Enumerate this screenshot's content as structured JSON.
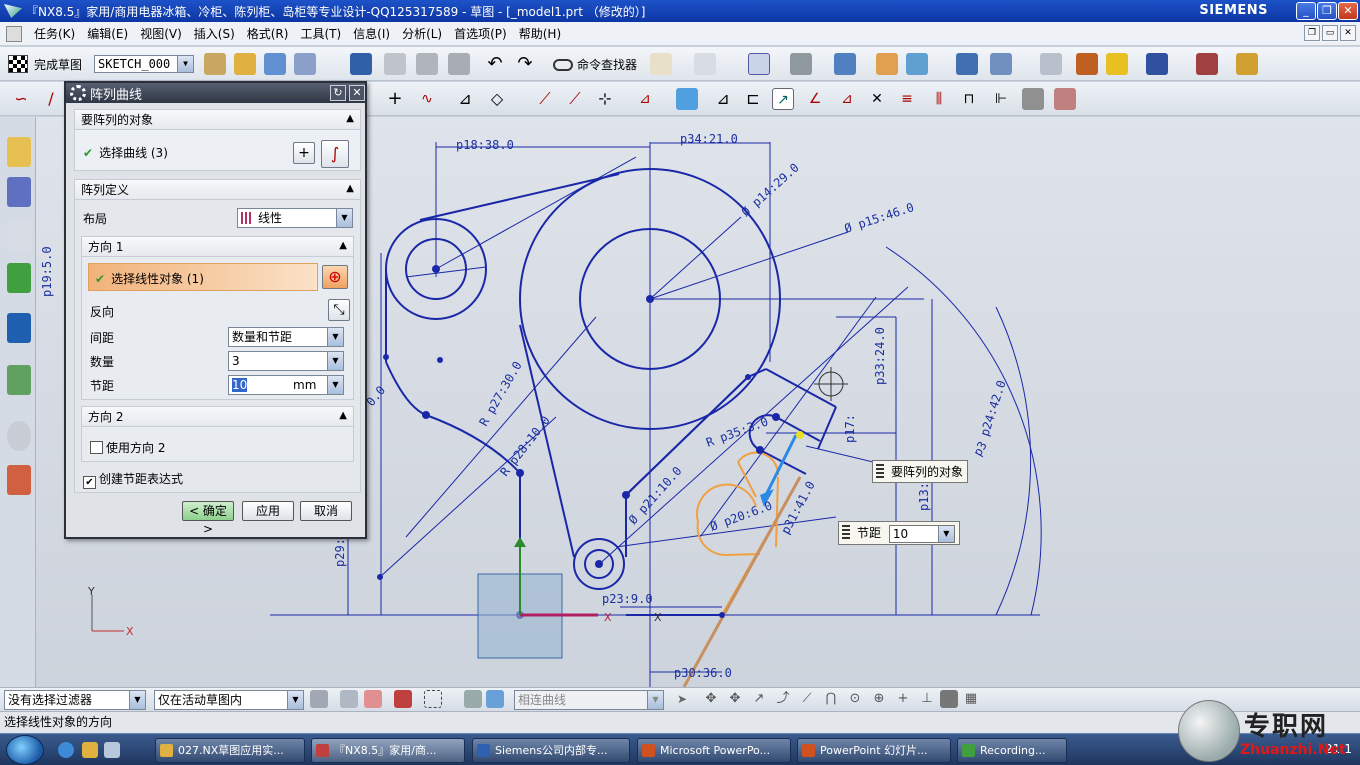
{
  "window": {
    "title": "『NX8.5』家用/商用电器冰箱、冷柜、陈列柜、岛柜等专业设计-QQ125317589 - 草图 - [_model1.prt （修改的）]",
    "brand": "SIEMENS"
  },
  "menu": [
    "任务(K)",
    "编辑(E)",
    "视图(V)",
    "插入(S)",
    "格式(R)",
    "工具(T)",
    "信息(I)",
    "分析(L)",
    "首选项(P)",
    "帮助(H)"
  ],
  "toolbar": {
    "finish_label": "完成草图",
    "sketch_name": "SKETCH_000",
    "command_finder": "命令查找器"
  },
  "dialog": {
    "title": "阵列曲线",
    "sec_objects": "要阵列的对象",
    "select_curve": "选择曲线 (3)",
    "sec_definition": "阵列定义",
    "layout_label": "布局",
    "layout_value": "线性",
    "dir1": "方向 1",
    "select_linear": "选择线性对象 (1)",
    "reverse": "反向",
    "spacing_label": "间距",
    "spacing_value": "数量和节距",
    "count_label": "数量",
    "count_value": "3",
    "pitch_label": "节距",
    "pitch_value": "10",
    "pitch_unit": "mm",
    "dir2": "方向 2",
    "use_dir2": "使用方向 2",
    "create_expr": "创建节距表达式",
    "ok": "< 确定 >",
    "apply": "应用",
    "cancel": "取消"
  },
  "canvas": {
    "dims": {
      "p18": "p18:38.0",
      "p34": "p34:21.0",
      "p14": "Ø p14:29.0",
      "p15": "Ø p15:46.0",
      "p19": "p19:5.0",
      "p27": "R p27:30.0",
      "p28": "R p28:10.0",
      "p21": "Ø p21:10.0",
      "p20": "Ø p20:6.0",
      "p31": "p31:41.0",
      "p35": "R p35:3.0",
      "p33": "p33:24.0",
      "p24": "p24:42.0",
      "p17": "p17:",
      "p13": "p13:",
      "p29": "p29:2",
      "p23": "p23:9.0",
      "p30": "p30:36.0",
      "p25": "0.0",
      "p32": "p3"
    },
    "axis_x": "X",
    "axis_y": "Y",
    "tip_objects": "要阵列的对象",
    "tip_pitch_label": "节距",
    "tip_pitch_value": "10"
  },
  "selection_bar": {
    "filter": "没有选择过滤器",
    "scope": "仅在活动草图内",
    "curve_rule": "相连曲线"
  },
  "status": "选择线性对象的方向",
  "taskbar": {
    "tasks": [
      "027.NX草图应用实...",
      "『NX8.5』家用/商...",
      "Siemens公司内部专...",
      "Microsoft PowerPo...",
      "PowerPoint 幻灯片...",
      "Recording..."
    ],
    "clock": "21:1"
  },
  "watermark": {
    "cn": "专职网",
    "url": "Zhuanzhi.Net"
  }
}
